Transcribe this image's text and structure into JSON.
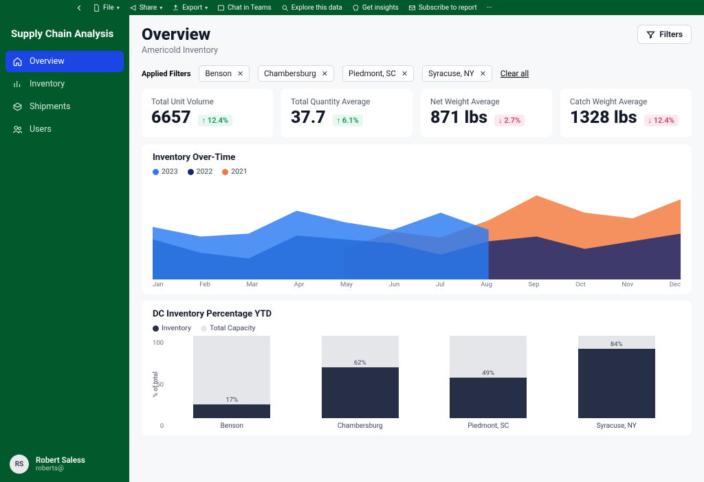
{
  "ribbon": {
    "file": "File",
    "share": "Share",
    "export": "Export",
    "chat_in_teams": "Chat in Teams",
    "explore_this_data": "Explore this data",
    "get_insights": "Get insights",
    "subscribe_to_report": "Subscribe to report"
  },
  "sidebar": {
    "app_title": "Supply Chain Analysis",
    "items": [
      {
        "label": "Overview",
        "active": true
      },
      {
        "label": "Inventory",
        "active": false
      },
      {
        "label": "Shipments",
        "active": false
      },
      {
        "label": "Users",
        "active": false
      }
    ]
  },
  "user": {
    "initials": "RS",
    "name": "Robert Saless",
    "email": "roberts@"
  },
  "page": {
    "title": "Overview",
    "subtitle": "Americold Inventory",
    "filters_button": "Filters",
    "applied_filters_label": "Applied Filters",
    "clear_all": "Clear all",
    "applied_filters": [
      "Benson",
      "Chambersburg",
      "Piedmont, SC",
      "Syracuse, NY"
    ]
  },
  "kpis": [
    {
      "label": "Total Unit Volume",
      "value": "6657",
      "delta": "12.4%",
      "dir": "up"
    },
    {
      "label": "Total Quantity Average",
      "value": "37.7",
      "delta": "6.1%",
      "dir": "up"
    },
    {
      "label": "Net Weight Average",
      "value": "871 lbs",
      "delta": "2.7%",
      "dir": "down"
    },
    {
      "label": "Catch Weight Average",
      "value": "1328 lbs",
      "delta": "12.4%",
      "dir": "down"
    }
  ],
  "colors": {
    "series_2023": "#2a7bf3",
    "series_2022": "#17276f",
    "series_2021": "#f3793b",
    "bar_fill": "#262f45",
    "bar_bg": "#e4e6ea"
  },
  "inventory_over_time": {
    "title": "Inventory Over-Time",
    "series_names": {
      "s2023": "2023",
      "s2022": "2022",
      "s2021": "2021"
    },
    "months": [
      "Jan",
      "Feb",
      "Mar",
      "Apr",
      "May",
      "Jun",
      "Jul",
      "Aug",
      "Sep",
      "Oct",
      "Nov",
      "Dec"
    ]
  },
  "dc_inventory": {
    "title": "DC Inventory Percentage YTD",
    "legend": {
      "inventory": "Inventory",
      "capacity": "Total Capacity"
    },
    "y_title": "% of total",
    "y_ticks": [
      "100",
      "50",
      "0"
    ],
    "bars": [
      {
        "label": "Benson",
        "pct": 17
      },
      {
        "label": "Chambersburg",
        "pct": 62
      },
      {
        "label": "Piedmont, SC",
        "pct": 49
      },
      {
        "label": "Syracuse, NY",
        "pct": 84
      }
    ]
  },
  "chart_data": [
    {
      "type": "area",
      "title": "Inventory Over-Time",
      "x": [
        "Jan",
        "Feb",
        "Mar",
        "Apr",
        "May",
        "Jun",
        "Jul",
        "Aug",
        "Sep",
        "Oct",
        "Nov",
        "Dec"
      ],
      "y_unit": "relative",
      "ylim": [
        0,
        100
      ],
      "series": [
        {
          "name": "2023",
          "color": "#2a7bf3",
          "values": [
            55,
            45,
            48,
            72,
            60,
            52,
            70,
            52,
            null,
            null,
            null,
            null
          ]
        },
        {
          "name": "2022",
          "color": "#17276f",
          "values": [
            42,
            28,
            22,
            46,
            42,
            38,
            26,
            40,
            45,
            32,
            40,
            48
          ]
        },
        {
          "name": "2021",
          "color": "#f3793b",
          "values": [
            null,
            null,
            null,
            null,
            32,
            50,
            44,
            62,
            88,
            70,
            64,
            84
          ]
        }
      ]
    },
    {
      "type": "bar",
      "title": "DC Inventory Percentage YTD",
      "ylabel": "% of total",
      "ylim": [
        0,
        100
      ],
      "categories": [
        "Benson",
        "Chambersburg",
        "Piedmont, SC",
        "Syracuse, NY"
      ],
      "series": [
        {
          "name": "Inventory",
          "color": "#262f45",
          "values": [
            17,
            62,
            49,
            84
          ]
        },
        {
          "name": "Total Capacity",
          "color": "#e4e6ea",
          "values": [
            100,
            100,
            100,
            100
          ]
        }
      ]
    }
  ]
}
